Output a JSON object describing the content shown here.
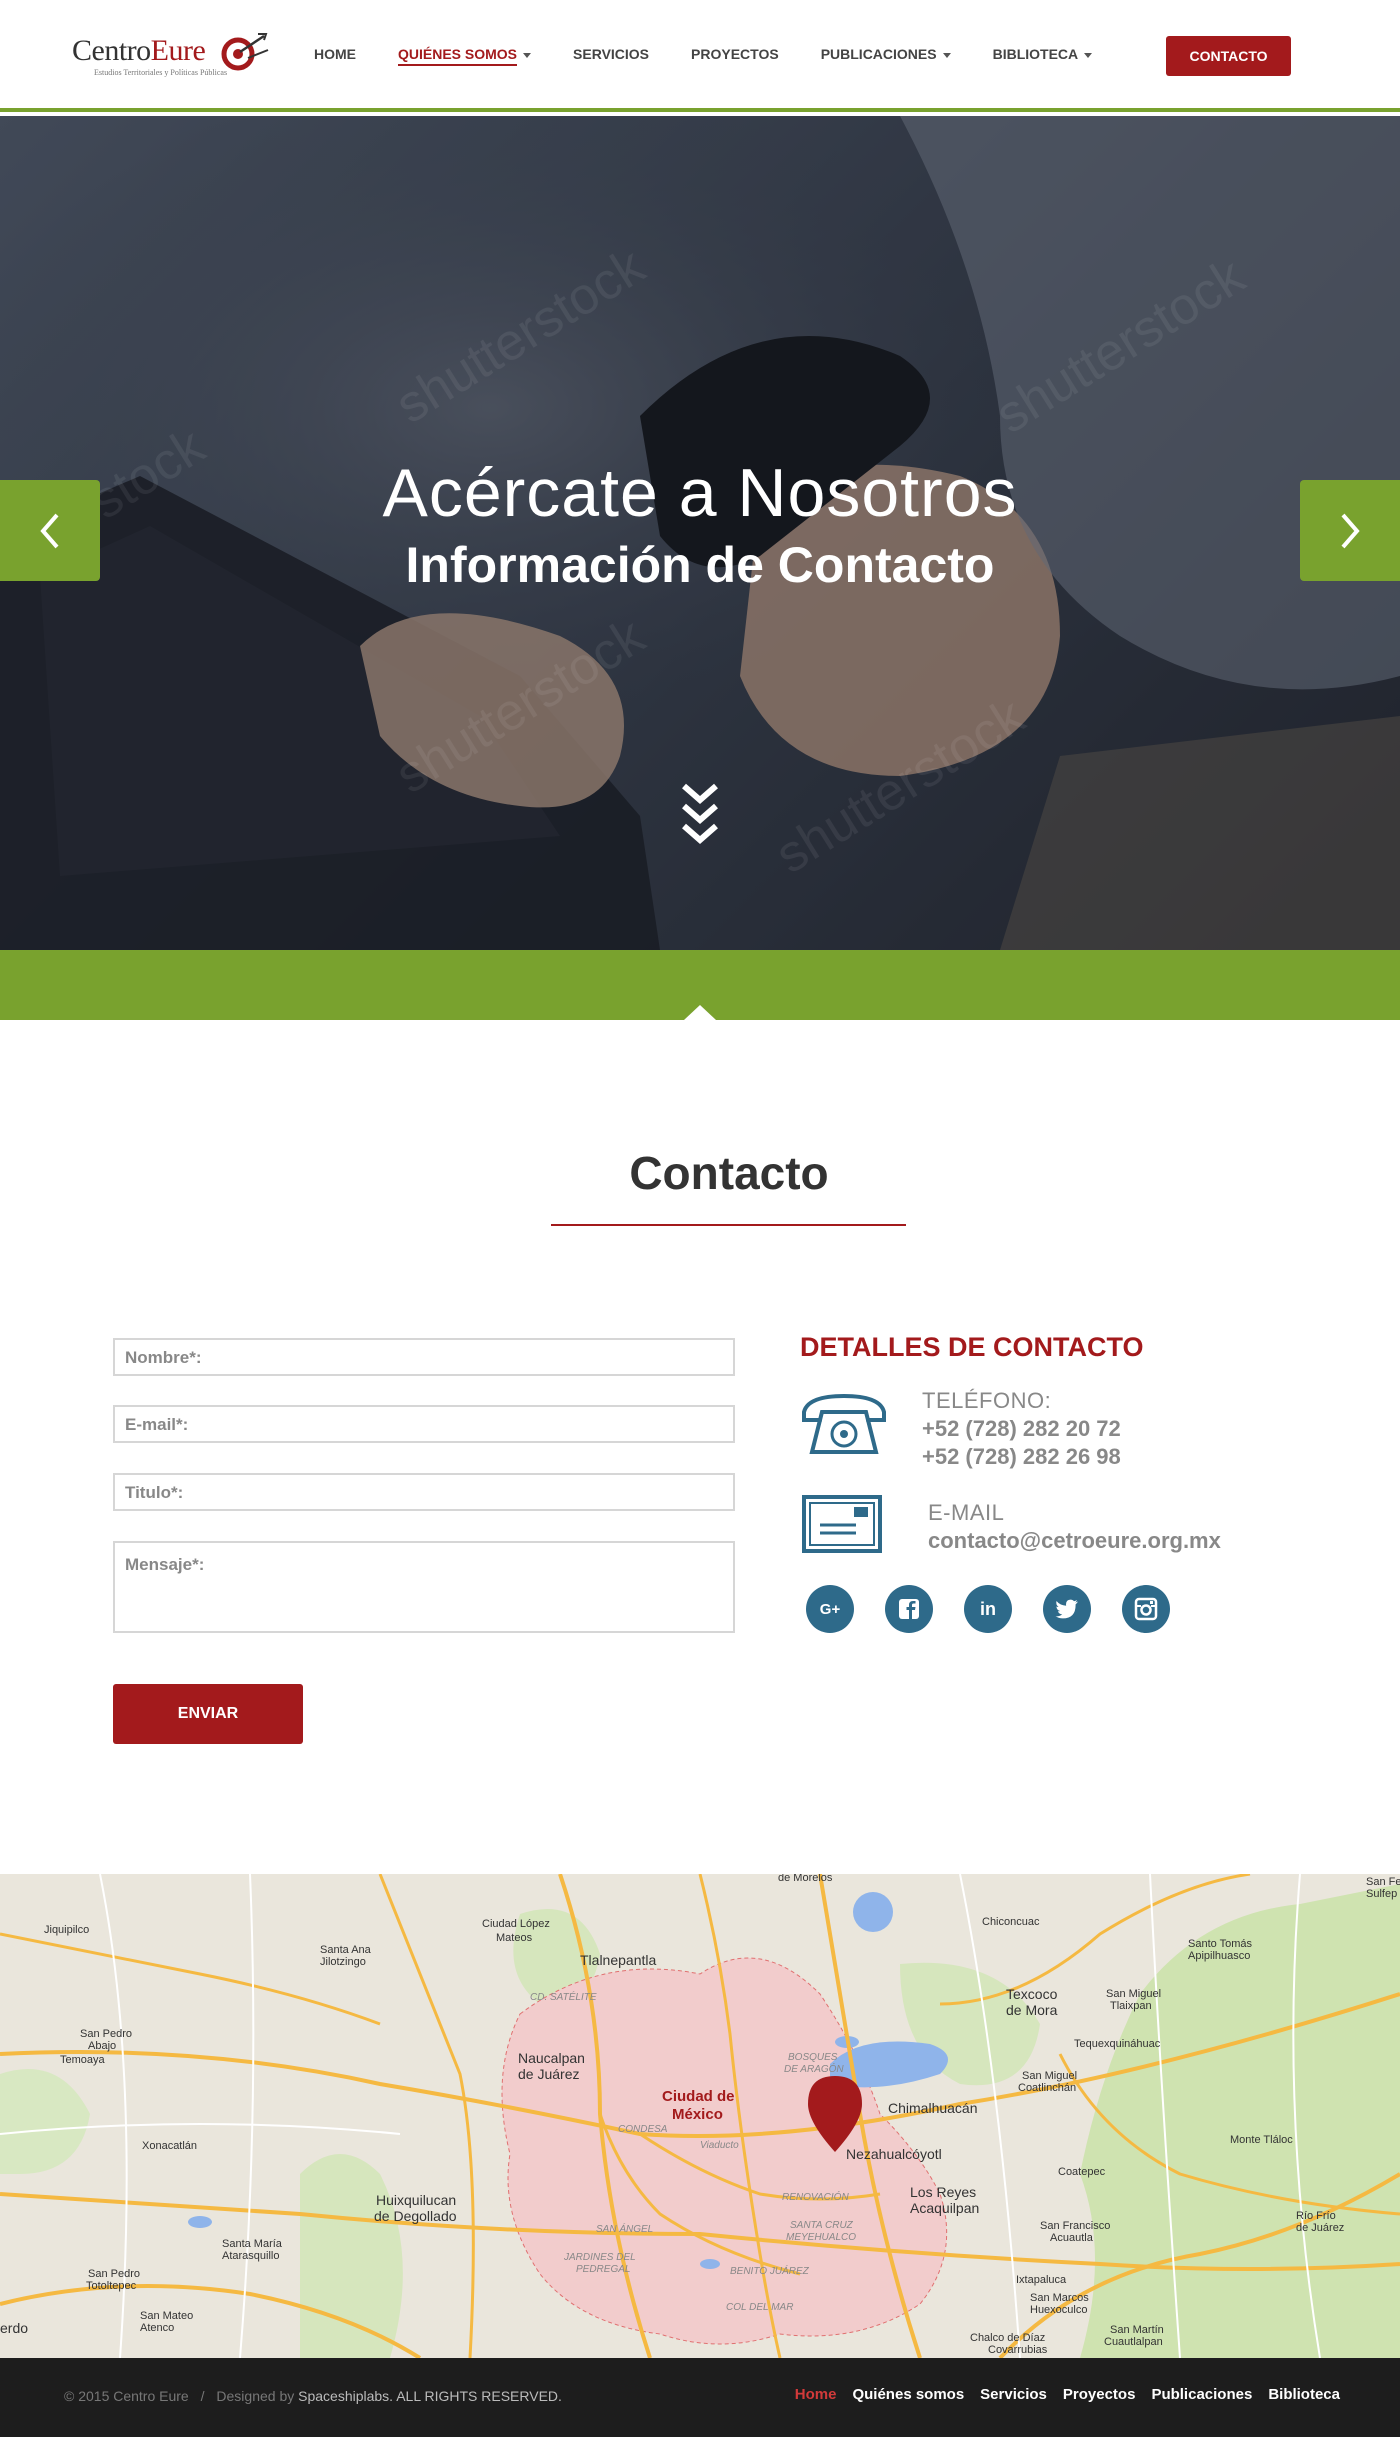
{
  "brand": {
    "logo_part1": "Centro",
    "logo_part2": "Eure",
    "logo_tagline": "Estudios Territoriales y Políticas Públicas"
  },
  "nav": {
    "items": [
      {
        "label": "HOME",
        "dropdown": false
      },
      {
        "label": "QUIÉNES SOMOS",
        "dropdown": true,
        "active": true
      },
      {
        "label": "SERVICIOS",
        "dropdown": false
      },
      {
        "label": "PROYECTOS",
        "dropdown": false
      },
      {
        "label": "PUBLICACIONES",
        "dropdown": true
      },
      {
        "label": "BIBLIOTECA",
        "dropdown": true
      }
    ],
    "cta": "CONTACTO"
  },
  "hero": {
    "title": "Acércate a Nosotros",
    "subtitle": "Información de Contacto",
    "watermark": "shutterstock",
    "prev_icon": "chevron-left-icon",
    "next_icon": "chevron-right-icon",
    "scroll_icon": "triple-chevron-down-icon"
  },
  "contact": {
    "section_title": "Contacto",
    "form": {
      "name_label": "Nombre*:",
      "email_label": "E-mail*:",
      "title_label": "Titulo*:",
      "message_label": "Mensaje*:",
      "submit": "ENVIAR"
    },
    "details": {
      "title": "DETALLES DE CONTACTO",
      "phone_label": "TELÉFONO:",
      "phone_1": "+52 (728) 282 20 72",
      "phone_2": "+52 (728) 282 26 98",
      "email_label": "E-MAIL",
      "email": "contacto@cetroeure.org.mx"
    },
    "social": [
      {
        "name": "google-plus",
        "glyph": "G+"
      },
      {
        "name": "facebook",
        "glyph": "f"
      },
      {
        "name": "linkedin",
        "glyph": "in"
      },
      {
        "name": "twitter",
        "glyph": "t"
      },
      {
        "name": "instagram",
        "glyph": "ig"
      }
    ]
  },
  "map": {
    "labels": {
      "tlalnepantla": "Tlalnepantla",
      "ciudad_mexico_1": "Ciudad de",
      "ciudad_mexico_2": "México",
      "nezahualcoyotl": "Nezahualcóyotl",
      "naucalpan_1": "Naucalpan",
      "naucalpan_2": "de Juárez",
      "chimalhuacan": "Chimalhuacán",
      "texcoco_1": "Texcoco",
      "texcoco_2": "de Mora",
      "los_reyes_1": "Los Reyes",
      "los_reyes_2": "Acaquilpan",
      "huixquilucan_1": "Huixquilucan",
      "huixquilucan_2": "de Degollado",
      "ciudad_lopez_1": "Ciudad López",
      "ciudad_lopez_2": "Mateos",
      "santa_ana": "Santa Ana",
      "jilotzingo": "Jilotzingo",
      "san_pedro_abajo_1": "San Pedro",
      "san_pedro_abajo_2": "Abajo",
      "temoaya": "Temoaya",
      "xonacatlan": "Xonacatlán",
      "jiquipilco": "Jiquipilco",
      "chiconcuac": "Chiconcuac",
      "santo_tomas_1": "Santo Tomás",
      "santo_tomas_2": "Apipilhuasco",
      "san_miguel_1": "San Miguel",
      "san_miguel_2": "Tlaixpan",
      "tequexquinahuac": "Tequexquináhuac",
      "san_miguel_coat_1": "San Miguel",
      "san_miguel_coat_2": "Coatlinchán",
      "monte_tlaloc": "Monte Tláloc",
      "coatepec": "Coatepec",
      "san_francisco_1": "San Francisco",
      "san_francisco_2": "Acuautla",
      "ixtapaluca": "Ixtapaluca",
      "santa_maria_1": "Santa María",
      "santa_maria_2": "Atarasquillo",
      "san_pedro_tot_1": "San Pedro",
      "san_pedro_tot_2": "Totoltepec",
      "san_mateo_1": "San Mateo",
      "san_mateo_2": "Atenco",
      "chalco": "Chalco de Díaz",
      "covarrubias": "Covarrubias",
      "san_martin_1": "San Martín",
      "san_martin_2": "Cuautlalpan",
      "san_marcos": "San Marcos",
      "huexoculco": "Huexoculco",
      "rio_frio_1": "Río Frío",
      "rio_frio_2": "de Juárez",
      "san_fe": "San Fe",
      "sulfepe": "Sulfep",
      "erdo": "erdo",
      "de_morelos": "de Morelos",
      "satelite": "CD. SATÉLITE",
      "condesa": "CONDESA",
      "renovacion": "RENOVACIÓN",
      "santa_cruz_1": "SANTA CRUZ",
      "santa_cruz_2": "MEYEHUALCO",
      "san_angel": "SAN ÁNGEL",
      "jardines_1": "JARDINES DEL",
      "jardines_2": "PEDREGAL",
      "benito_juarez": "BENITO JUÁREZ",
      "col_del_mar": "COL DEL MAR",
      "bosques_1": "BOSQUES",
      "bosques_2": "DE ARAGÓN",
      "viaducto": "Viaducto"
    },
    "pin_icon": "map-pin-icon"
  },
  "footer": {
    "copyright": "© 2015 Centro Eure",
    "separator": "/",
    "designed_by": "Designed by",
    "designer": "Spaceshiplabs.",
    "rights": "ALL RIGHTS RESERVED.",
    "links": [
      {
        "label": "Home",
        "active": true
      },
      {
        "label": "Quiénes somos"
      },
      {
        "label": "Servicios"
      },
      {
        "label": "Proyectos"
      },
      {
        "label": "Publicaciones"
      },
      {
        "label": "Biblioteca"
      }
    ]
  },
  "colors": {
    "brand_red": "#a31a1c",
    "accent_green": "#79a22e",
    "icon_blue": "#2e6a8a",
    "footer_bg": "#1d1d1d"
  }
}
